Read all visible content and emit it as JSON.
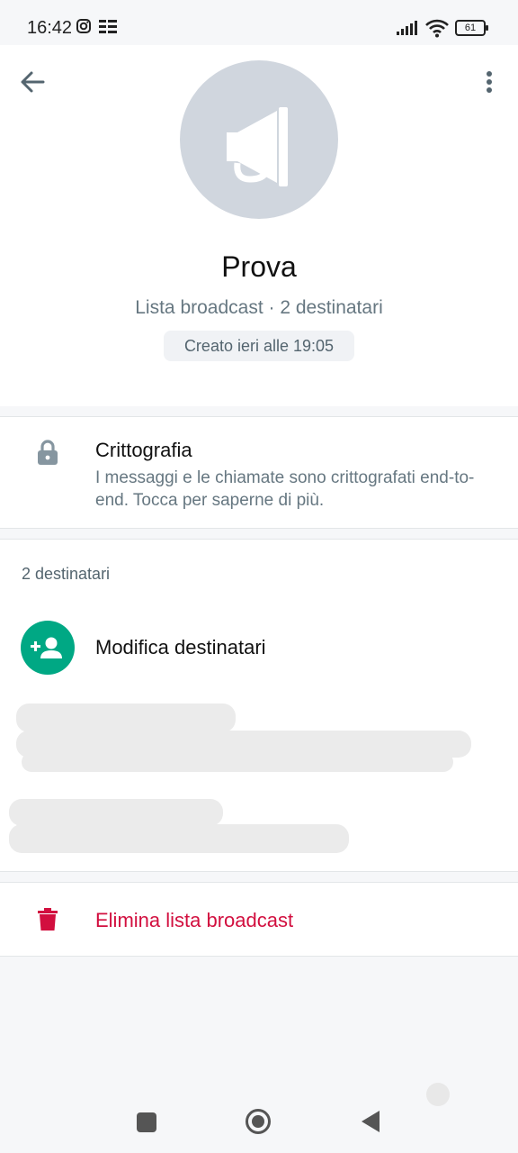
{
  "status_bar": {
    "time": "16:42",
    "battery": "61"
  },
  "header": {
    "title": "Prova",
    "subtitle": "Lista broadcast · 2 destinatari",
    "created": "Creato ieri alle 19:05"
  },
  "encryption": {
    "title": "Crittografia",
    "description": "I messaggi e le chiamate sono crittografati end-to-end. Tocca per saperne di più."
  },
  "recipients": {
    "count_label": "2 destinatari",
    "edit_label": "Modifica destinatari"
  },
  "delete": {
    "label": "Elimina lista broadcast"
  },
  "colors": {
    "accent_green": "#00a884",
    "danger_red": "#d20f3f",
    "avatar_bg": "#d0d6de"
  },
  "icons": {
    "back": "arrow-left-icon",
    "menu": "more-vert-icon",
    "avatar": "megaphone-icon",
    "lock": "lock-icon",
    "add_person": "person-add-icon",
    "trash": "trash-icon"
  }
}
